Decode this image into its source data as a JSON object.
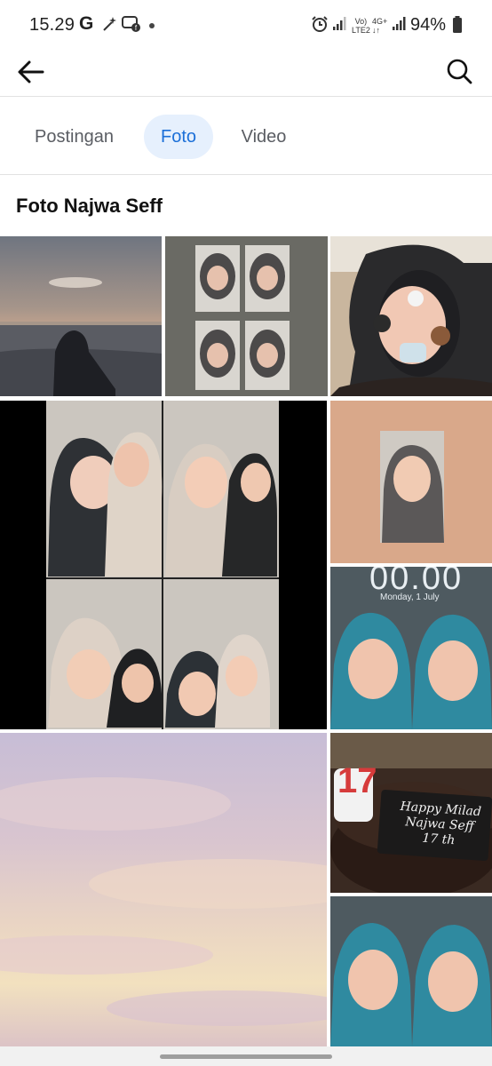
{
  "status_bar": {
    "time": "15.29",
    "google_letter": "G",
    "net_vo": "Vo)",
    "net_lte": "LTE2",
    "net_4g": "4G+",
    "battery": "94%"
  },
  "header": {
    "back_icon": "arrow-left-icon",
    "search_icon": "search-icon"
  },
  "tabs": [
    {
      "label": "Postingan",
      "active": false
    },
    {
      "label": "Foto",
      "active": true
    },
    {
      "label": "Video",
      "active": false
    }
  ],
  "section_title": "Foto Najwa Seff",
  "photos": {
    "lockscreen_time": "00.00",
    "lockscreen_date": "Monday, 1 July",
    "cake_number": "17",
    "cake_text_line1": "Happy Milad",
    "cake_text_line2": "Najwa Seff",
    "cake_text_line3": "17 th"
  },
  "colors": {
    "accent": "#1b6fd8",
    "active_tab_bg": "#e6f0fd",
    "hijab_teal": "#2f8aa0",
    "peach_bg": "#d9a88a"
  }
}
